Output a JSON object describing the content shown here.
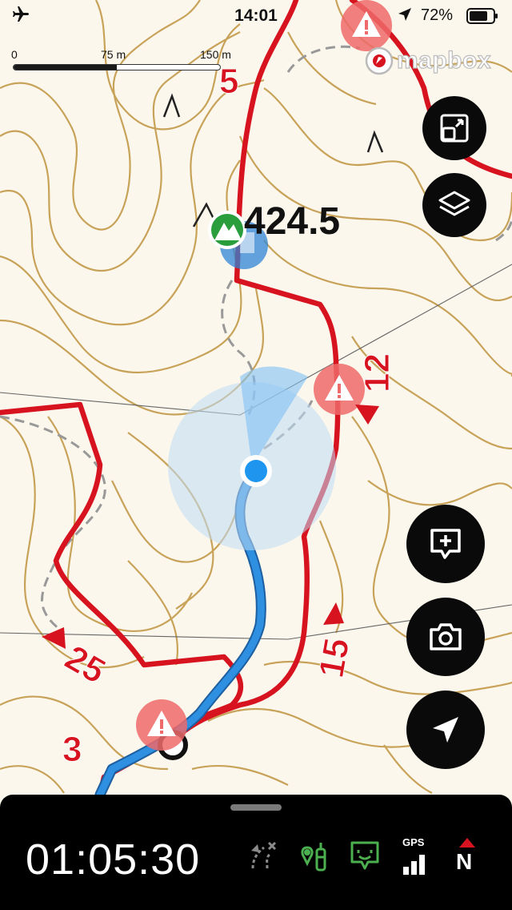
{
  "status_bar": {
    "time": "14:01",
    "battery_percent": "72%",
    "airplane_icon": "airplane-icon",
    "location_icon": "location-arrow-icon",
    "battery_level": 0.72
  },
  "scale_bar": {
    "start_label": "0",
    "mid_label": "75 m",
    "end_label": "150 m"
  },
  "attribution": {
    "text": "mapbox"
  },
  "map": {
    "peak_elevation": "424.5",
    "trail_numbers": [
      "5",
      "12",
      "25",
      "15",
      "3"
    ],
    "colors": {
      "contour": "#c8a258",
      "trail": "#d6131f",
      "track": "#2f8fe0",
      "warning": "#ef6a6a",
      "peak": "#2a9d3c"
    }
  },
  "controls": {
    "fit_bounds_icon": "fit-bounds-icon",
    "layers_icon": "layers-icon",
    "add_note_icon": "add-note-icon",
    "camera_icon": "camera-icon",
    "locate_icon": "navigation-arrow-icon"
  },
  "bottom_sheet": {
    "elapsed_time": "01:05:30",
    "gps_label": "GPS",
    "compass_label": "N",
    "icons": [
      "route-off-icon",
      "hike-mode-icon",
      "message-icon",
      "gps-signal-icon",
      "compass-icon"
    ]
  }
}
